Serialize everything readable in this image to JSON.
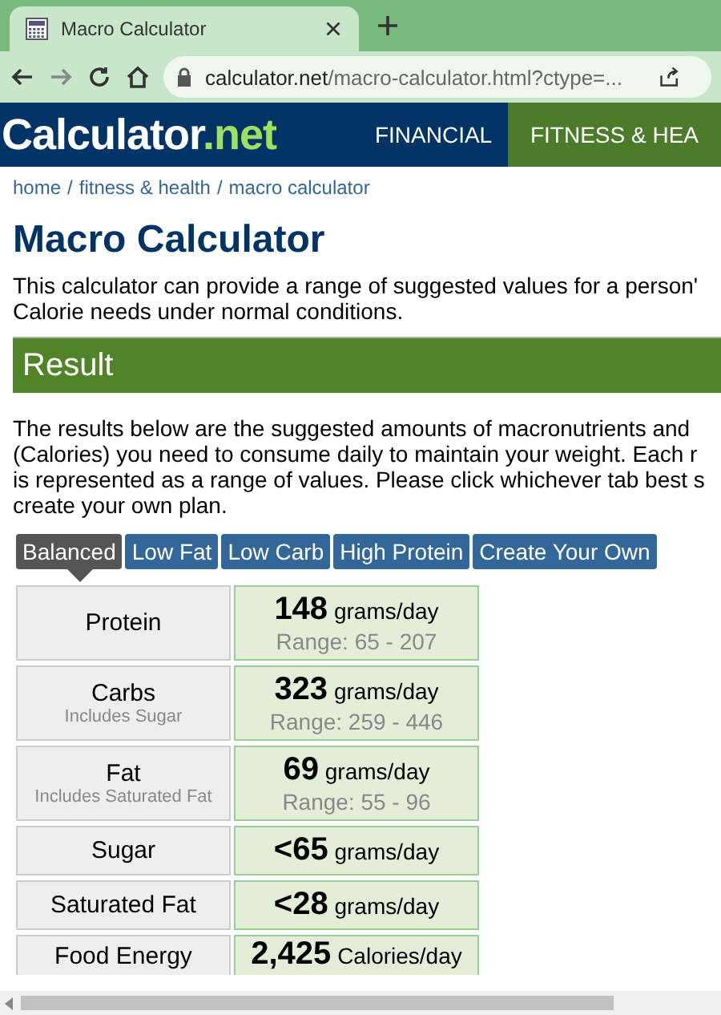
{
  "browser": {
    "tab_title": "Macro Calculator",
    "url_host": "calculator.net",
    "url_path": "/macro-calculator.html?ctype=..."
  },
  "site": {
    "logo_main": "Calculator",
    "logo_dot": ".",
    "logo_net": "net",
    "nav": [
      {
        "label": "FINANCIAL",
        "selected": false
      },
      {
        "label": "FITNESS & HEA",
        "selected": true
      }
    ]
  },
  "breadcrumb": [
    "home",
    "fitness & health",
    "macro calculator"
  ],
  "breadcrumb_separator": "/",
  "title": "Macro Calculator",
  "intro": [
    "This calculator can provide a range of suggested values for a person'",
    "Calorie needs under normal conditions."
  ],
  "result_heading": "Result",
  "result_text": [
    "The results below are the suggested amounts of macronutrients and",
    "(Calories) you need to consume daily to maintain your weight. Each r",
    "is represented as a range of values. Please click whichever tab best s",
    "create your own plan."
  ],
  "plans": [
    {
      "label": "Balanced",
      "selected": true
    },
    {
      "label": "Low Fat",
      "selected": false
    },
    {
      "label": "Low Carb",
      "selected": false
    },
    {
      "label": "High Protein",
      "selected": false
    },
    {
      "label": "Create Your Own",
      "selected": false
    }
  ],
  "rows": [
    {
      "name": "Protein",
      "value": "148",
      "unit": "grams/day",
      "range": "Range: 65 - 207"
    },
    {
      "name": "Carbs",
      "note": "Includes Sugar",
      "value": "323",
      "unit": "grams/day",
      "range": "Range: 259 - 446"
    },
    {
      "name": "Fat",
      "note": "Includes Saturated Fat",
      "value": "69",
      "unit": "grams/day",
      "range": "Range: 55 - 96"
    },
    {
      "name": "Sugar",
      "value": "<65",
      "unit": "grams/day"
    },
    {
      "name": "Saturated Fat",
      "value": "<28",
      "unit": "grams/day"
    },
    {
      "name": "Food Energy",
      "value": "2,425",
      "unit": "Calories/day"
    }
  ]
}
